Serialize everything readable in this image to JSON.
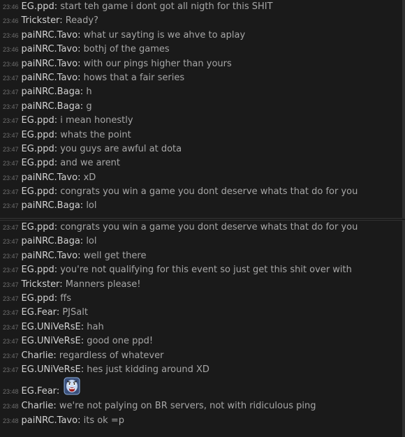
{
  "chat_top": [
    {
      "time": "23:46",
      "author": "EG.ppd",
      "message": "start teh game i dont got all nigth for this SHIT"
    },
    {
      "time": "23:46",
      "author": "Trickster",
      "message": "Ready?"
    },
    {
      "time": "23:46",
      "author": "paiNRC.Tavo",
      "message": "what ur sayting is we ahve to aplay"
    },
    {
      "time": "23:46",
      "author": "paiNRC.Tavo",
      "message": "bothj of the games"
    },
    {
      "time": "23:46",
      "author": "paiNRC.Tavo",
      "message": "with our pings higher than yours"
    },
    {
      "time": "23:47",
      "author": "paiNRC.Tavo",
      "message": "hows that a fair series"
    },
    {
      "time": "23:47",
      "author": "paiNRC.Baga",
      "message": "h"
    },
    {
      "time": "23:47",
      "author": "paiNRC.Baga",
      "message": "g"
    },
    {
      "time": "23:47",
      "author": "EG.ppd",
      "message": "i mean honestly"
    },
    {
      "time": "23:47",
      "author": "EG.ppd",
      "message": "whats the point"
    },
    {
      "time": "23:47",
      "author": "EG.ppd",
      "message": "you guys are awful at dota"
    },
    {
      "time": "23:47",
      "author": "EG.ppd",
      "message": "and we arent"
    },
    {
      "time": "23:47",
      "author": "paiNRC.Tavo",
      "message": "xD"
    },
    {
      "time": "23:47",
      "author": "EG.ppd",
      "message": "congrats you win a game you dont deserve whats that do for you"
    },
    {
      "time": "23:47",
      "author": "paiNRC.Baga",
      "message": "lol"
    }
  ],
  "chat_bottom": [
    {
      "time": "23:47",
      "author": "EG.ppd",
      "message": "congrats you win a game you dont deserve whats that do for you"
    },
    {
      "time": "23:47",
      "author": "paiNRC.Baga",
      "message": "lol"
    },
    {
      "time": "23:47",
      "author": "paiNRC.Tavo",
      "message": "well get there"
    },
    {
      "time": "23:47",
      "author": "EG.ppd",
      "message": "you're not qualifying for this event so just get this shit over with"
    },
    {
      "time": "23:47",
      "author": "Trickster",
      "message": "Manners please!"
    },
    {
      "time": "23:47",
      "author": "EG.ppd",
      "message": "ffs"
    },
    {
      "time": "23:47",
      "author": "EG.Fear",
      "message": "PJSalt"
    },
    {
      "time": "23:47",
      "author": "EG.UNiVeRsE",
      "message": "hah"
    },
    {
      "time": "23:47",
      "author": "EG.UNiVeRsE",
      "message": "good one ppd!"
    },
    {
      "time": "23:47",
      "author": "Charlie",
      "message": "regardless of whatever"
    },
    {
      "time": "23:47",
      "author": "EG.UNiVeRsE",
      "message": "hes just kidding around XD"
    },
    {
      "time": "23:48",
      "author": "EG.Fear",
      "message": "",
      "emote": "angry-face-emote-icon"
    },
    {
      "time": "23:48",
      "author": "Charlie",
      "message": "we're not palying on BR servers, not with ridiculous ping"
    },
    {
      "time": "23:48",
      "author": "paiNRC.Tavo",
      "message": "its ok =p"
    }
  ]
}
